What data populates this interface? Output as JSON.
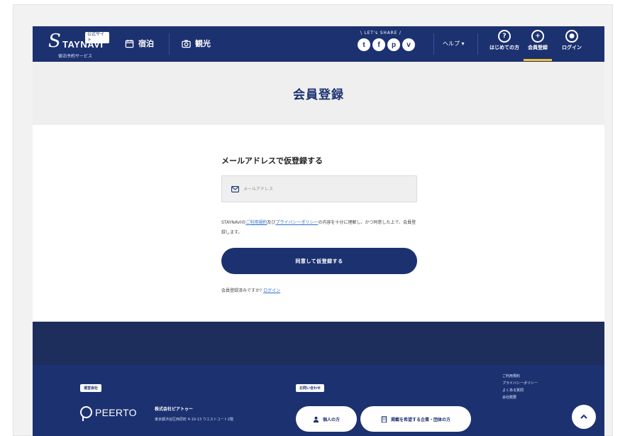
{
  "header": {
    "logo": {
      "mark": "S",
      "word": "TAYNAVI",
      "badge": "公式サイト",
      "tagline": "宿泊予約サービス"
    },
    "nav": {
      "stay": "宿泊",
      "sightseeing": "観光"
    },
    "share": {
      "label": "\\ LET's SHARE /",
      "icons": [
        {
          "name": "twitter",
          "glyph": "t"
        },
        {
          "name": "facebook",
          "glyph": "f"
        },
        {
          "name": "pinterest",
          "glyph": "p"
        },
        {
          "name": "pocket",
          "glyph": "v"
        }
      ]
    },
    "help": "ヘルプ ▾",
    "buttons": {
      "first_time": "はじめての方",
      "register": "会員登録",
      "login": "ログイン"
    },
    "accent": "#f2c12e",
    "brand": "#1c3170"
  },
  "page": {
    "title": "会員登録"
  },
  "form": {
    "heading": "メールアドレスで仮登録する",
    "email_placeholder": "メールアドレス",
    "terms_pre": "STAYNAVIの",
    "terms_link1": "ご利用規約",
    "terms_mid": "及び",
    "terms_link2": "プライバシーポリシー",
    "terms_post": "の内容を十分に理解し、かつ同意した上で、会員登録します。",
    "submit": "同意して仮登録する",
    "already": "会員登録済みですか?",
    "login_link": "ログイン"
  },
  "footer": {
    "operator_tag": "運営会社",
    "company_logo": "PEERTO",
    "company_name": "株式会社ピアトゥー",
    "address": "東京都渋谷区西原町 4-10-13  ウエストコート2階",
    "contact_tag": "お問い合わせ",
    "individual": "個人の方",
    "corporate": "掲載を希望する企業・団体の方",
    "links": [
      "ご利用規約",
      "プライバシーポリシー",
      "よくある質問",
      "会社概要"
    ]
  }
}
